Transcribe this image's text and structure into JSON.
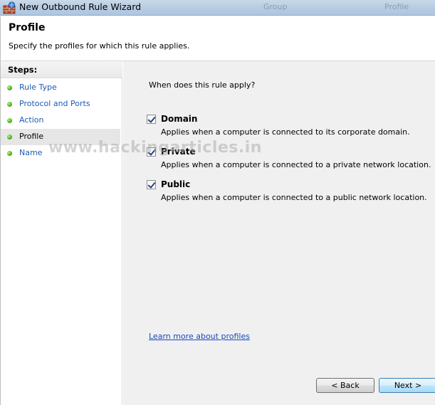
{
  "window": {
    "title": "New Outbound Rule Wizard",
    "background_columns": [
      "Group",
      "Profile"
    ]
  },
  "header": {
    "title": "Profile",
    "description": "Specify the profiles for which this rule applies."
  },
  "steps": {
    "heading": "Steps:",
    "items": [
      {
        "label": "Rule Type",
        "current": false
      },
      {
        "label": "Protocol and Ports",
        "current": false
      },
      {
        "label": "Action",
        "current": false
      },
      {
        "label": "Profile",
        "current": true
      },
      {
        "label": "Name",
        "current": false
      }
    ]
  },
  "content": {
    "question": "When does this rule apply?",
    "options": [
      {
        "title": "Domain",
        "description": "Applies when a computer is connected to its corporate domain.",
        "checked": true
      },
      {
        "title": "Private",
        "description": "Applies when a computer is connected to a private network location.",
        "checked": true
      },
      {
        "title": "Public",
        "description": "Applies when a computer is connected to a public network location.",
        "checked": true
      }
    ],
    "learn_more_link": "Learn more about profiles"
  },
  "buttons": {
    "back": "< Back",
    "next": "Next >"
  },
  "watermark": "www.hackingarticles.in",
  "colors": {
    "link": "#1d47b8",
    "step_link": "#1e5bb4",
    "step_dot": "#4fb51e",
    "content_bg": "#f0f0f0"
  }
}
